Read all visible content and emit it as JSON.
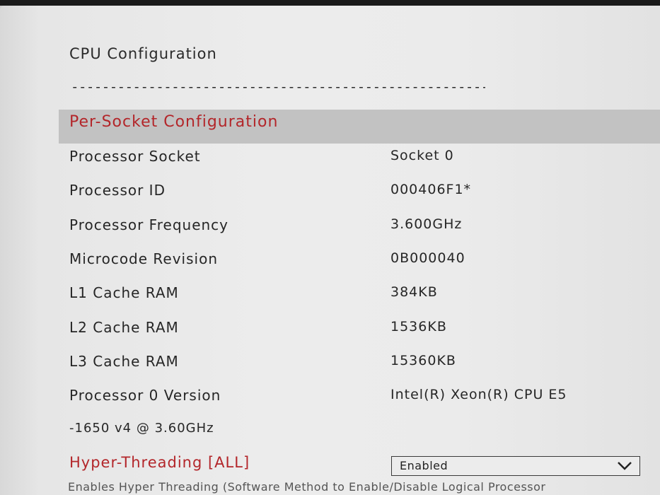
{
  "header": {
    "title": "CPU Configuration",
    "separator": "--------------------------------------------------------------"
  },
  "section": {
    "title": "Per-Socket Configuration"
  },
  "rows": [
    {
      "label": "Processor Socket",
      "value": "Socket 0"
    },
    {
      "label": "Processor ID",
      "value": "000406F1*"
    },
    {
      "label": "Processor Frequency",
      "value": "3.600GHz"
    },
    {
      "label": "Microcode Revision",
      "value": "0B000040"
    },
    {
      "label": "L1 Cache RAM",
      "value": "384KB"
    },
    {
      "label": "L2 Cache RAM",
      "value": "1536KB"
    },
    {
      "label": "L3 Cache RAM",
      "value": "15360KB"
    },
    {
      "label": "Processor 0 Version",
      "value": "Intel(R) Xeon(R) CPU E5"
    },
    {
      "label": "-1650 v4 @ 3.60GHz",
      "value": ""
    }
  ],
  "hyper_threading": {
    "label": "Hyper-Threading [ALL]",
    "selected": "Enabled",
    "help": "Enables Hyper Threading (Software Method to Enable/Disable Logical Processor"
  },
  "icons": {
    "dropdown": "chevron-down-icon"
  },
  "colors": {
    "highlight": "#b3262a",
    "section_band": "#c2c2c2",
    "background": "#ebebeb"
  }
}
